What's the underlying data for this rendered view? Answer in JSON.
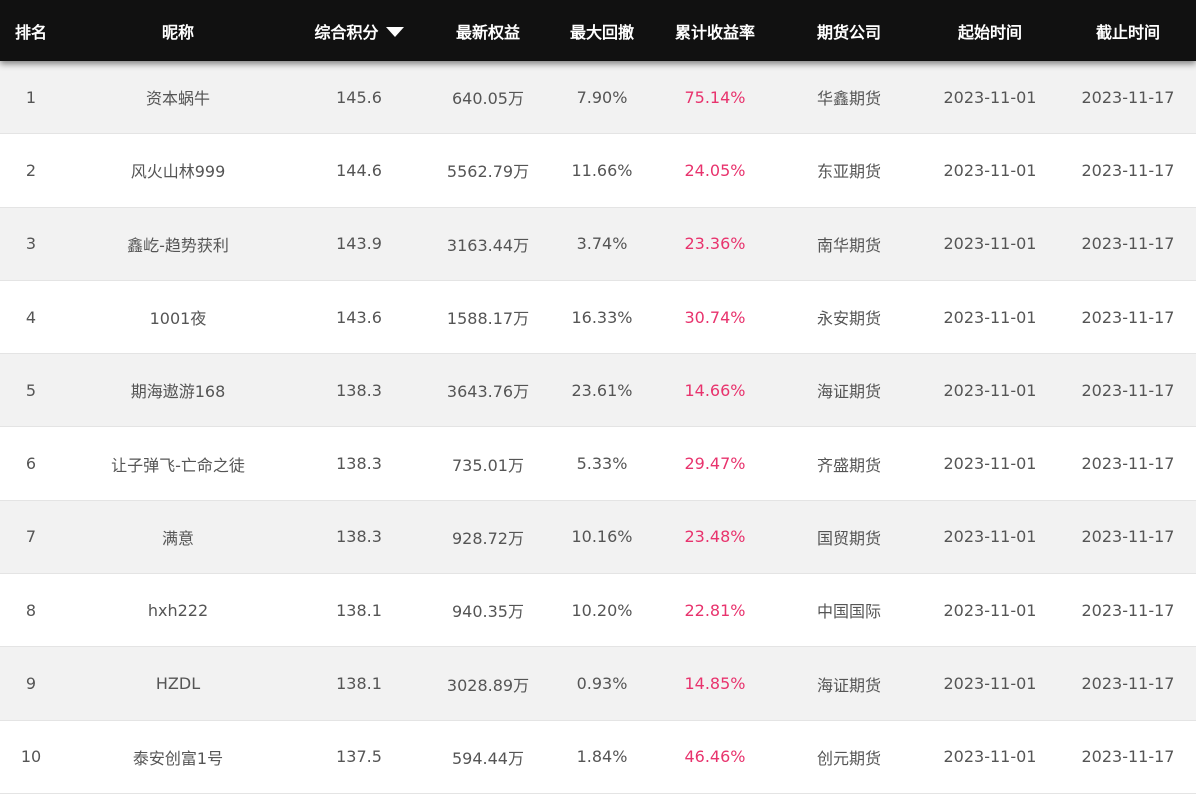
{
  "headers": {
    "rank": "排名",
    "name": "昵称",
    "score": "综合积分",
    "equity": "最新权益",
    "drawdown": "最大回撤",
    "return_rate": "累计收益率",
    "company": "期货公司",
    "start": "起始时间",
    "end": "截止时间"
  },
  "sort_icon": "caret-down-icon",
  "colors": {
    "header_bg": "#111111",
    "return_rate": "#e8336d",
    "row_alt": "#f2f2f2"
  },
  "rows": [
    {
      "rank": "1",
      "name": "资本蜗牛",
      "score": "145.6",
      "equity": "640.05万",
      "drawdown": "7.90%",
      "return_rate": "75.14%",
      "company": "华鑫期货",
      "start": "2023-11-01",
      "end": "2023-11-17"
    },
    {
      "rank": "2",
      "name": "风火山林999",
      "score": "144.6",
      "equity": "5562.79万",
      "drawdown": "11.66%",
      "return_rate": "24.05%",
      "company": "东亚期货",
      "start": "2023-11-01",
      "end": "2023-11-17"
    },
    {
      "rank": "3",
      "name": "鑫屹-趋势获利",
      "score": "143.9",
      "equity": "3163.44万",
      "drawdown": "3.74%",
      "return_rate": "23.36%",
      "company": "南华期货",
      "start": "2023-11-01",
      "end": "2023-11-17"
    },
    {
      "rank": "4",
      "name": "1001夜",
      "score": "143.6",
      "equity": "1588.17万",
      "drawdown": "16.33%",
      "return_rate": "30.74%",
      "company": "永安期货",
      "start": "2023-11-01",
      "end": "2023-11-17"
    },
    {
      "rank": "5",
      "name": "期海遨游168",
      "score": "138.3",
      "equity": "3643.76万",
      "drawdown": "23.61%",
      "return_rate": "14.66%",
      "company": "海证期货",
      "start": "2023-11-01",
      "end": "2023-11-17"
    },
    {
      "rank": "6",
      "name": "让子弹飞-亡命之徒",
      "score": "138.3",
      "equity": "735.01万",
      "drawdown": "5.33%",
      "return_rate": "29.47%",
      "company": "齐盛期货",
      "start": "2023-11-01",
      "end": "2023-11-17"
    },
    {
      "rank": "7",
      "name": "满意",
      "score": "138.3",
      "equity": "928.72万",
      "drawdown": "10.16%",
      "return_rate": "23.48%",
      "company": "国贸期货",
      "start": "2023-11-01",
      "end": "2023-11-17"
    },
    {
      "rank": "8",
      "name": "hxh222",
      "score": "138.1",
      "equity": "940.35万",
      "drawdown": "10.20%",
      "return_rate": "22.81%",
      "company": "中国国际",
      "start": "2023-11-01",
      "end": "2023-11-17"
    },
    {
      "rank": "9",
      "name": "HZDL",
      "score": "138.1",
      "equity": "3028.89万",
      "drawdown": "0.93%",
      "return_rate": "14.85%",
      "company": "海证期货",
      "start": "2023-11-01",
      "end": "2023-11-17"
    },
    {
      "rank": "10",
      "name": "泰安创富1号",
      "score": "137.5",
      "equity": "594.44万",
      "drawdown": "1.84%",
      "return_rate": "46.46%",
      "company": "创元期货",
      "start": "2023-11-01",
      "end": "2023-11-17"
    }
  ]
}
